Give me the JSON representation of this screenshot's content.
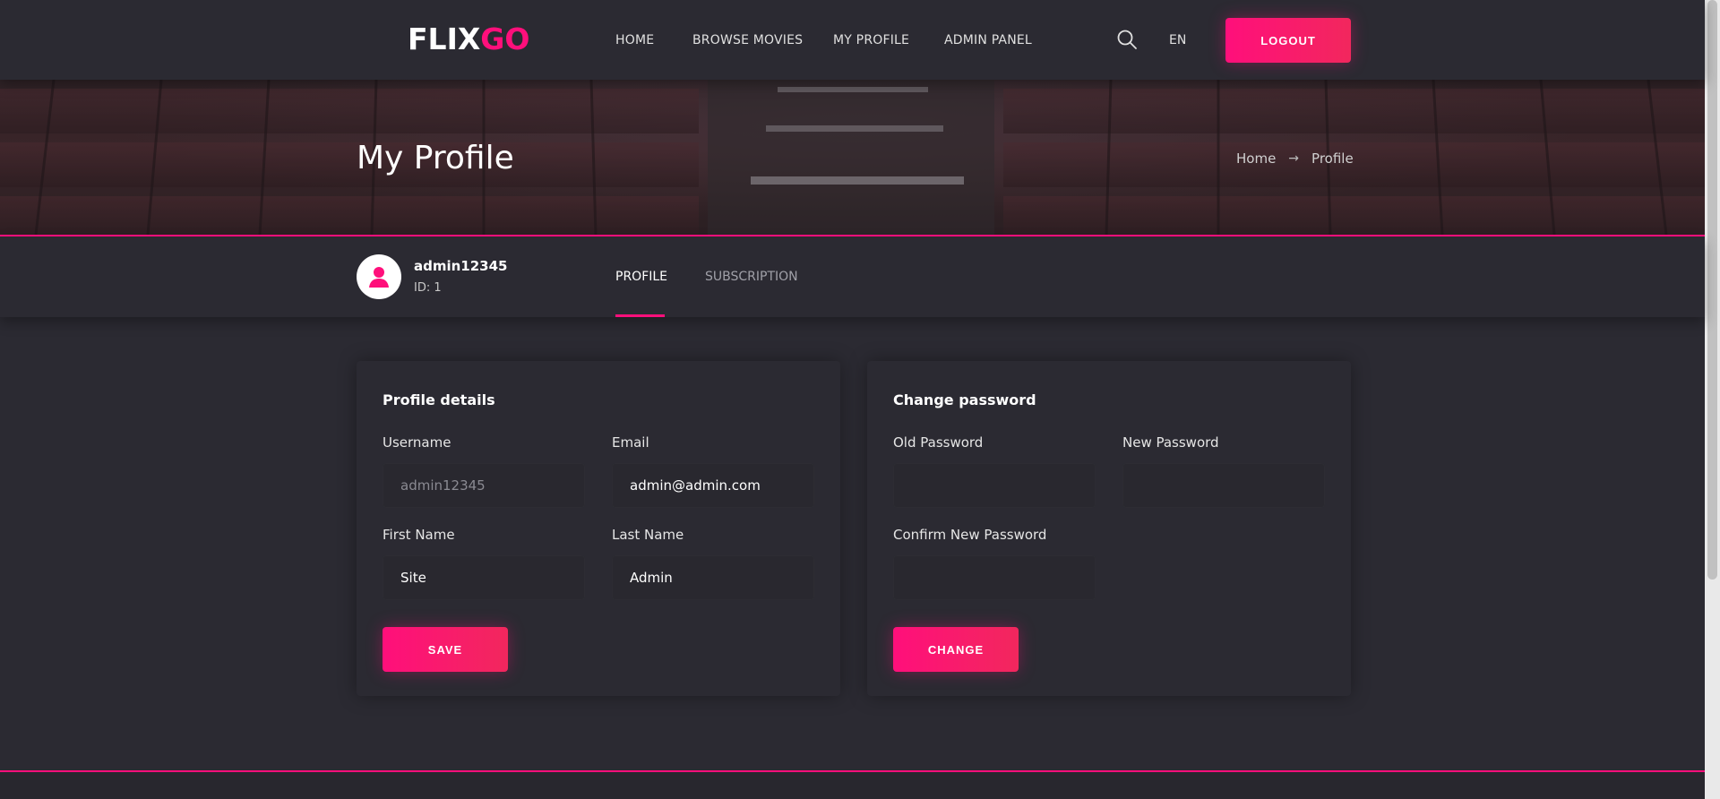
{
  "header": {
    "logo_white": "FLIX",
    "logo_pink": "GO",
    "nav": [
      "HOME",
      "BROWSE MOVIES",
      "MY PROFILE",
      "ADMIN PANEL"
    ],
    "language": "EN",
    "logout_label": "LOGOUT",
    "search_icon": "search-icon"
  },
  "banner": {
    "title": "My Profile",
    "breadcrumb": [
      "Home",
      "Profile"
    ]
  },
  "profile": {
    "username": "admin12345",
    "id_text": "ID: 1",
    "tabs": [
      "PROFILE",
      "SUBSCRIPTION"
    ],
    "active_tab": "PROFILE"
  },
  "profile_details": {
    "title": "Profile details",
    "username_label": "Username",
    "username_value": "admin12345",
    "email_label": "Email",
    "email_value": "admin@admin.com",
    "first_name_label": "First Name",
    "first_name_value": "Site",
    "last_name_label": "Last Name",
    "last_name_value": "Admin",
    "save_label": "SAVE"
  },
  "change_password": {
    "title": "Change password",
    "old_label": "Old Password",
    "new_label": "New Password",
    "confirm_label": "Confirm New Password",
    "change_label": "CHANGE"
  },
  "colors": {
    "accent": "#ff0f7b",
    "background": "#2b2a32"
  }
}
